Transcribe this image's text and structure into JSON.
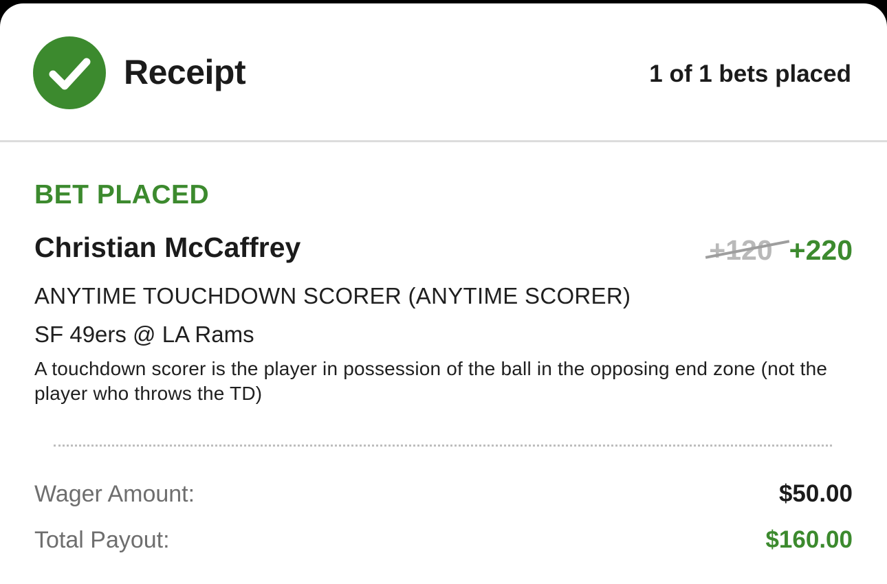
{
  "header": {
    "title": "Receipt",
    "bets_placed": "1 of 1 bets placed",
    "status_icon": "check-circle-icon"
  },
  "bet": {
    "status": "BET PLACED",
    "player": "Christian McCaffrey",
    "odds_original": "+120",
    "odds_boosted": "+220",
    "market": "ANYTIME TOUCHDOWN SCORER (ANYTIME SCORER)",
    "event": "SF 49ers @ LA Rams",
    "description": "A touchdown scorer is the player in possession of the ball in the opposing end zone (not the player who throws the TD)"
  },
  "summary": {
    "wager_label": "Wager Amount:",
    "wager_value": "$50.00",
    "payout_label": "Total Payout:",
    "payout_value": "$160.00"
  },
  "colors": {
    "accent_green": "#3c8a2e",
    "text_dark": "#1b1b1b",
    "text_muted": "#6e6e6e",
    "strike_gray": "#b9b9b9"
  }
}
